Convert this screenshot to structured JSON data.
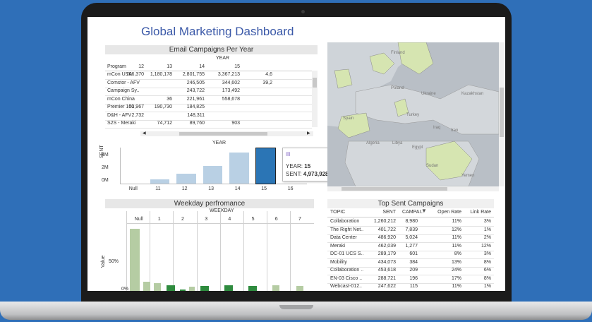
{
  "dashboard": {
    "title": "Global Marketing Dashboard"
  },
  "email": {
    "title": "Email Campaigns Per Year",
    "year_label": "YEAR",
    "program_label": "Program",
    "years": [
      "12",
      "13",
      "14",
      "15",
      ""
    ],
    "rows": [
      {
        "program": "mCon USA",
        "v": [
          "706,370",
          "1,180,178",
          "2,801,755",
          "3,367,213",
          "4,6"
        ]
      },
      {
        "program": "Comstor - AFV",
        "v": [
          "",
          "",
          "246,505",
          "344,602",
          "39,2"
        ]
      },
      {
        "program": "Campaign Sy..",
        "v": [
          "",
          "",
          "243,722",
          "173,492",
          ""
        ]
      },
      {
        "program": "mCon China",
        "v": [
          "",
          "36",
          "221,961",
          "558,678",
          ""
        ]
      },
      {
        "program": "Premier 100",
        "v": [
          "51,967",
          "190,730",
          "184,825",
          "",
          ""
        ]
      },
      {
        "program": "D&H - AFV",
        "v": [
          "2,732",
          "",
          "148,311",
          "",
          ""
        ]
      },
      {
        "program": "S2S - Meraki",
        "v": [
          "",
          "74,712",
          "89,760",
          "903",
          ""
        ]
      }
    ]
  },
  "sent_chart": {
    "year_label": "YEAR",
    "y_axis_label": "SENT",
    "y_ticks": [
      "4M",
      "2M",
      "0M"
    ],
    "tooltip_year_label": "YEAR:",
    "tooltip_year_value": "15",
    "tooltip_sent_label": "SENT:",
    "tooltip_sent_value": "4,973,928"
  },
  "chart_data": {
    "type": "bar",
    "categories": [
      "Null",
      "11",
      "12",
      "13",
      "14",
      "15",
      "16"
    ],
    "values": [
      0,
      600000,
      1400000,
      2500000,
      4400000,
      4973928,
      0
    ],
    "ylabel": "SENT",
    "ylim": [
      0,
      5000000
    ]
  },
  "weekday": {
    "title": "Weekday perfromance",
    "weekday_label": "WEEKDAY",
    "columns": [
      "Null",
      "1",
      "2",
      "3",
      "4",
      "5",
      "6",
      "7"
    ],
    "y_axis_label": "Value",
    "y_tick_50": "50%",
    "y_tick_0": "0%"
  },
  "top_campaigns": {
    "title": "Top Sent Campaigns",
    "headers": {
      "topic": "TOPIC",
      "sent": "SENT",
      "campaigns": "CAMPAI..",
      "open_rate": "Open Rate",
      "link_rate": "Link Rate"
    },
    "rows": [
      [
        "Collaboration",
        "1,260,212",
        "8,980",
        "11%",
        "3%"
      ],
      [
        "The Right Net..",
        "401,722",
        "7,839",
        "12%",
        "1%"
      ],
      [
        "Data Center",
        "486,920",
        "5,024",
        "11%",
        "2%"
      ],
      [
        "Meraki",
        "462,039",
        "1,277",
        "11%",
        "12%"
      ],
      [
        "DC-01 UCS S..",
        "289,179",
        "601",
        "8%",
        "3%"
      ],
      [
        "Mobility",
        "434,073",
        "384",
        "13%",
        "8%"
      ],
      [
        "Collaboration ..",
        "453,618",
        "209",
        "24%",
        "6%"
      ],
      [
        "EN-03 Cisco ..",
        "288,721",
        "196",
        "17%",
        "8%"
      ],
      [
        "Webcast-012..",
        "247,622",
        "115",
        "11%",
        "1%"
      ]
    ]
  },
  "map": {
    "labels": [
      "Finland",
      "Poland",
      "Ukraine",
      "Kazakhstan",
      "Spain",
      "Turkey",
      "Iraq",
      "Iran",
      "Algeria",
      "Libya",
      "Egypt",
      "Sudan",
      "Yemen"
    ]
  },
  "colors": {
    "title": "#3b59a8",
    "bar_light": "#b9d0e4",
    "bar_selected": "#2b75b5",
    "green_light": "#b5cca3",
    "green_dark": "#2e8b3e",
    "background": "#2f6fb8"
  }
}
